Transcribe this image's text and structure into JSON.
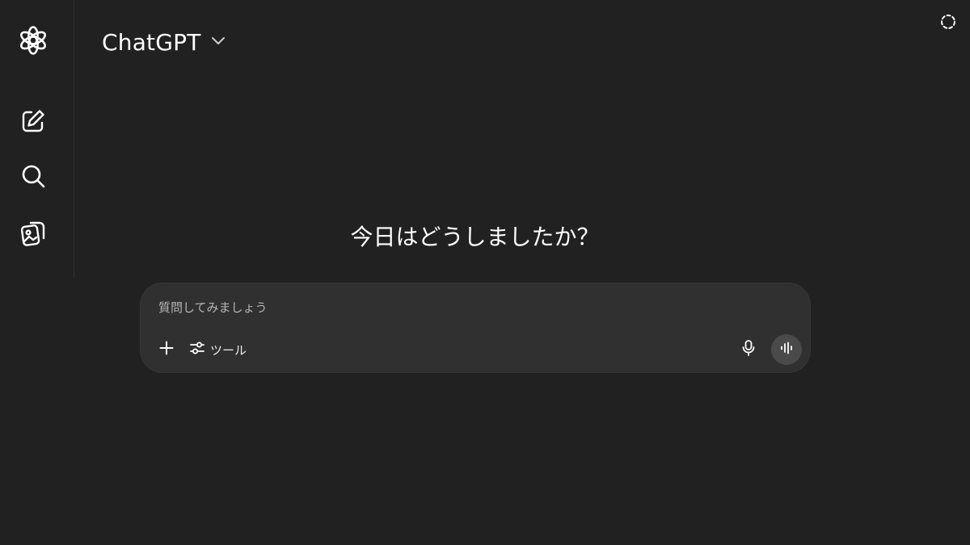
{
  "header": {
    "model_name": "ChatGPT"
  },
  "sidebar": {
    "items": [
      {
        "icon": "openai-logo-icon"
      },
      {
        "icon": "new-chat-icon"
      },
      {
        "icon": "search-icon"
      },
      {
        "icon": "library-icon"
      }
    ]
  },
  "main": {
    "greeting": "今日はどうしましたか？"
  },
  "composer": {
    "placeholder": "質問してみましょう",
    "value": "",
    "tools_label": "ツール"
  },
  "colors": {
    "background": "#212121",
    "composer_bg": "#303030",
    "voice_button_bg": "#4a4a4a",
    "text": "#ffffff"
  }
}
